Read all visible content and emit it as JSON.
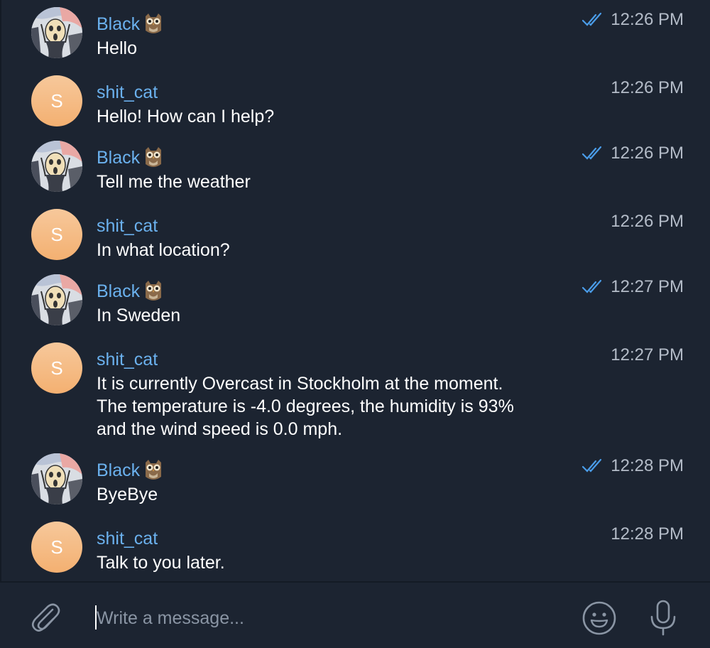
{
  "colors": {
    "background": "#1c2431",
    "sender_name": "#6bb1ee",
    "message_text": "#ffffff",
    "timestamp": "#b4bcc8",
    "read_ticks": "#4a9ce8",
    "bot_avatar": "#f4b071"
  },
  "messages": [
    {
      "sender": "Black",
      "sender_emoji": "owl-emoji",
      "avatar": "scream-painting-avatar",
      "text": "Hello",
      "time": "12:26 PM",
      "read": true
    },
    {
      "sender": "shit_cat",
      "avatar_letter": "S",
      "text": "Hello! How can I help?",
      "time": "12:26 PM",
      "read": false
    },
    {
      "sender": "Black",
      "sender_emoji": "owl-emoji",
      "avatar": "scream-painting-avatar",
      "text": "Tell me the weather",
      "time": "12:26 PM",
      "read": true
    },
    {
      "sender": "shit_cat",
      "avatar_letter": "S",
      "text": "In what location?",
      "time": "12:26 PM",
      "read": false
    },
    {
      "sender": "Black",
      "sender_emoji": "owl-emoji",
      "avatar": "scream-painting-avatar",
      "text": "In Sweden",
      "time": "12:27 PM",
      "read": true
    },
    {
      "sender": "shit_cat",
      "avatar_letter": "S",
      "text_lines": [
        "It is currently Overcast in Stockholm at the moment.",
        "The temperature is -4.0 degrees, the humidity is 93%",
        "and the wind speed is 0.0 mph."
      ],
      "time": "12:27 PM",
      "read": false
    },
    {
      "sender": "Black",
      "sender_emoji": "owl-emoji",
      "avatar": "scream-painting-avatar",
      "text": "ByeBye",
      "time": "12:28 PM",
      "read": true
    },
    {
      "sender": "shit_cat",
      "avatar_letter": "S",
      "text": "Talk to you later.",
      "time": "12:28 PM",
      "read": false
    }
  ],
  "composer": {
    "placeholder": "Write a message...",
    "value": "",
    "attach_icon": "paperclip-icon",
    "emoji_icon": "smiley-icon",
    "voice_icon": "microphone-icon"
  }
}
